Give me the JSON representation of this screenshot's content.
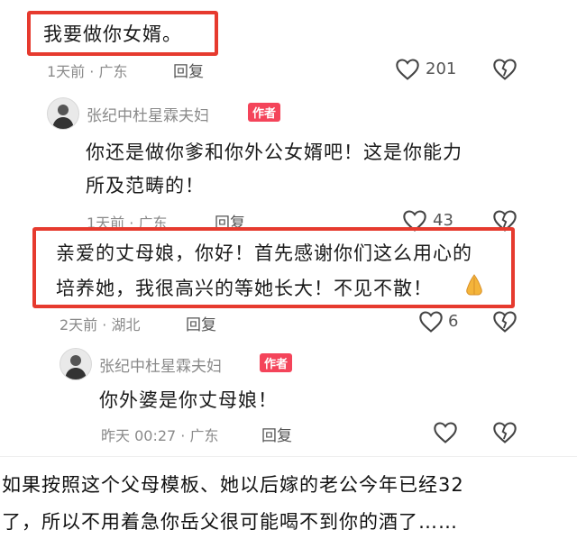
{
  "comments": [
    {
      "text": "我要做你女婿。",
      "meta": "1天前 · 广东",
      "reply_label": "回复",
      "likes": "201"
    },
    {
      "username": "张纪中杜星霖夫妇",
      "badge": "作者",
      "lines": [
        "你还是做你爹和你外公女婿吧！这是你能力",
        "所及范畴的！"
      ],
      "meta": "1天前 · 广东",
      "reply_label": "回复",
      "likes": "43"
    },
    {
      "lines": [
        "亲爱的丈母娘，你好！首先感谢你们这么用心的",
        "培养她，我很高兴的等她长大！不见不散！"
      ],
      "meta": "2天前 · 湖北",
      "reply_label": "回复",
      "likes": "6"
    },
    {
      "username": "张纪中杜星霖夫妇",
      "badge": "作者",
      "text": "你外婆是你丈母娘！",
      "meta": "昨天 00:27 · 广东",
      "reply_label": "回复",
      "likes": ""
    }
  ],
  "caption": {
    "lines": [
      "如果按照这个父母模板、她以后嫁的老公今年已经32",
      "了，所以不用着急你岳父很可能喝不到你的酒了……"
    ]
  },
  "colors": {
    "highlight_border": "#e63a2e",
    "author_badge": "#f4445a",
    "meta_text": "#8a8a8a"
  },
  "icons": [
    "heart-icon",
    "broken-heart-icon",
    "pray-hands-emoji"
  ]
}
